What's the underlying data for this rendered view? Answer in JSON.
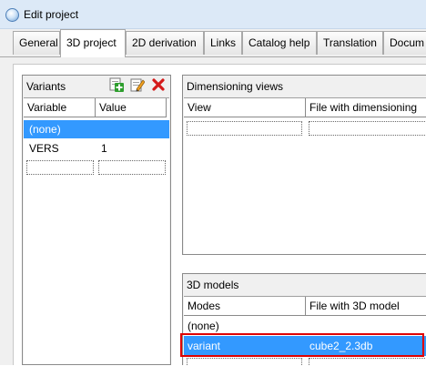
{
  "window": {
    "title": "Edit project"
  },
  "tabs": [
    {
      "label": "General"
    },
    {
      "label": "3D project"
    },
    {
      "label": "2D derivation"
    },
    {
      "label": "Links"
    },
    {
      "label": "Catalog help"
    },
    {
      "label": "Translation"
    },
    {
      "label": "Docum"
    }
  ],
  "variants": {
    "title": "Variants",
    "toolbar": {
      "add_icon": "add-icon",
      "edit_icon": "edit-icon",
      "delete_icon": "delete-icon"
    },
    "columns": [
      "Variable",
      "Value"
    ],
    "rows": [
      {
        "variable": "(none)",
        "value": ""
      },
      {
        "variable": "VERS",
        "value": "1"
      }
    ]
  },
  "dimensioning_views": {
    "title": "Dimensioning views",
    "columns": [
      "View",
      "File with dimensioning"
    ]
  },
  "models_3d": {
    "title": "3D models",
    "columns": [
      "Modes",
      "File with 3D model"
    ],
    "rows": [
      {
        "mode": "(none)",
        "file": ""
      },
      {
        "mode": "variant",
        "file": "cube2_2.3db"
      }
    ]
  },
  "colors": {
    "selection": "#3399ff",
    "highlight_border": "#e00000",
    "titlebar": "#dce9f7"
  }
}
